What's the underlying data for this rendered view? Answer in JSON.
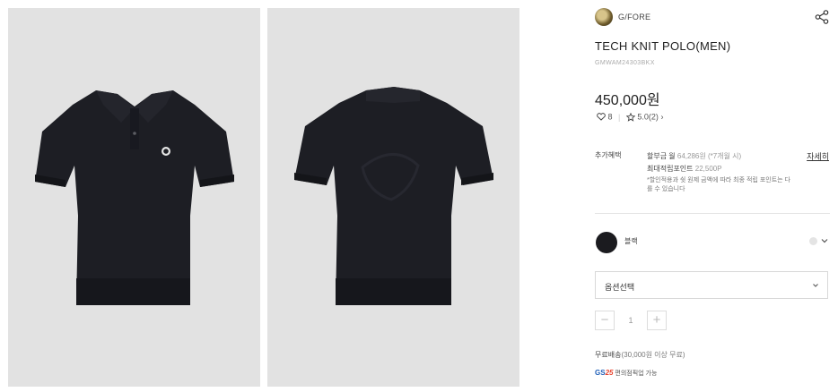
{
  "brand": {
    "name": "G/FORE"
  },
  "product": {
    "title": "TECH KNIT POLO(MEN)",
    "code": "GMWAM24303BKX",
    "price": "450,000원",
    "wish_count": "8",
    "rating": "5.0(2)"
  },
  "benefits": {
    "label": "추가혜택",
    "installment_prefix": "할부금 월 ",
    "installment_amount": "64,286원 (*7개월 시)",
    "points_label": "최대적립포인트 ",
    "points_value": "22,500P",
    "note": "*할인적용과 쉿 원제 금액에 따라 최종 적립 포인트는 다를 수 있습니다",
    "more_link": "자세히"
  },
  "color": {
    "name": "블랙",
    "swatch": "#1b1b1f"
  },
  "option": {
    "placeholder": "옵션선택"
  },
  "quantity": {
    "value": "1",
    "minus": "−",
    "plus": "+"
  },
  "shipping": {
    "label": "무료배송",
    "detail": "(30,000원 이상 무료)"
  },
  "pickup": {
    "logo_prefix": "GS",
    "logo_number": "25",
    "text": " 편의점픽업 가능"
  },
  "icons": {
    "share": "share-icon",
    "heart": "heart-icon",
    "star": "star-icon",
    "chevron": "chevron-down-icon"
  },
  "colors": {
    "photo_bg": "#e2e2e2",
    "garment": "#1d1e24",
    "accent_blue": "#1f5fb8",
    "accent_red": "#e8442e"
  }
}
